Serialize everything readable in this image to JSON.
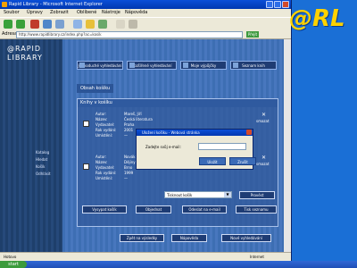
{
  "window": {
    "title": "Rapid Library - Microsoft Internet Explorer"
  },
  "menu": [
    "Soubor",
    "Úpravy",
    "Zobrazit",
    "Oblíbené",
    "Nástroje",
    "Nápověda"
  ],
  "address": {
    "label": "Adresa",
    "url": "http://www.rapidlibrary.cz/index.php?ac=kosik",
    "go_label": "Přejít"
  },
  "brand": {
    "line1": "@RAPID",
    "line2": "LIBRARY",
    "corner_logo": "@RL"
  },
  "left_nav": [
    "Katalog",
    "Hledat",
    "Košík",
    "Odhlásit"
  ],
  "nav_tabs": [
    "Jednoduché vyhledávání",
    "Rozšířené vyhledávání",
    "Moje výpůjčky",
    "Seznam knih"
  ],
  "section_title": "Obsah košíku",
  "panel_title": "Knihy v košíku",
  "items": [
    {
      "author_label": "Autor:",
      "author": "Mareš, Jiří",
      "title_label": "Název:",
      "title": "Česká literatura",
      "publisher_label": "Vydavatel:",
      "publisher": "Praha",
      "year_label": "Rok vydání:",
      "year": "2001",
      "location_label": "Umístění:",
      "location": "—",
      "delete_label": "smazat"
    },
    {
      "author_label": "Autor:",
      "author": "Novák, Pavel",
      "title_label": "Název:",
      "title": "Dějiny",
      "publisher_label": "Vydavatel:",
      "publisher": "Brno",
      "year_label": "Rok vydání:",
      "year": "1999",
      "location_label": "Umístění:",
      "location": "—",
      "delete_label": "smazat"
    }
  ],
  "select": {
    "value": "Tisknout košík"
  },
  "action_button": "Provést",
  "buttons_row1": [
    "Vysypat košík",
    "Objednat",
    "Odeslat na e-mail",
    "Tisk seznamu"
  ],
  "buttons_row2": [
    "Zpět na výsledky",
    "Nápověda",
    "Nové vyhledávání"
  ],
  "dialog": {
    "title": "Uložení košíku - Webová stránka",
    "label": "Zadejte svůj e-mail:",
    "input_value": "",
    "ok_label": "Uložit",
    "cancel_label": "Zrušit"
  },
  "status": {
    "text": "Hotovo",
    "zone": "Internet"
  },
  "taskbar": {
    "start": "start"
  }
}
